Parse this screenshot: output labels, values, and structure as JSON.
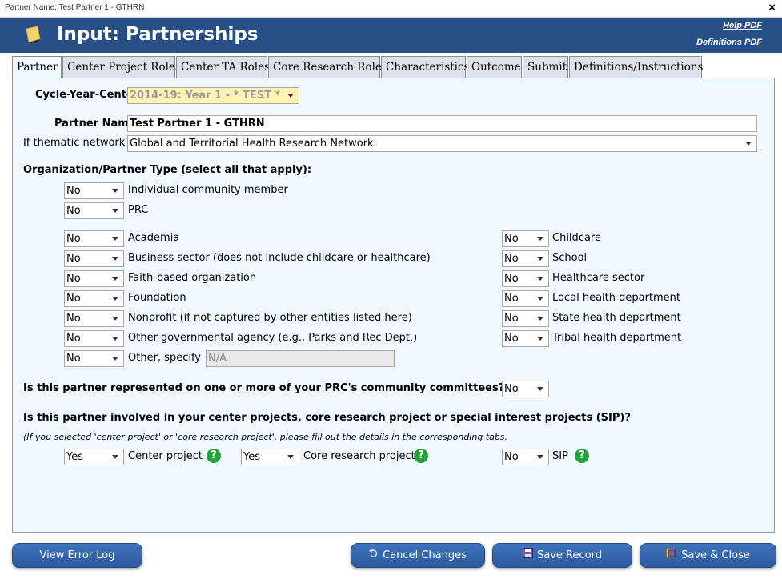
{
  "window": {
    "title": "Partner Name: Test Partner 1 - GTHRN",
    "close_glyph": "×"
  },
  "header": {
    "title": "Input: Partnerships",
    "help_pdf": "Help PDF",
    "definitions_pdf": "Definitions PDF",
    "icon": "note-icon"
  },
  "tabs": [
    {
      "label": "Partner",
      "active": true
    },
    {
      "label": "Center Project Roles"
    },
    {
      "label": "Center TA Roles"
    },
    {
      "label": "Core Research Roles"
    },
    {
      "label": "Characteristics"
    },
    {
      "label": "Outcome"
    },
    {
      "label": "Submit"
    },
    {
      "label": "Definitions/Instructions"
    }
  ],
  "form": {
    "cycle_label": "Cycle-Year-Center",
    "cycle_value": "2014-19: Year 1 - * TEST *",
    "partner_name_label": "Partner Name",
    "partner_name_value": "Test Partner 1 - GTHRN",
    "thematic_label": "If thematic network",
    "thematic_value": "Global and Territorial Health Research Network",
    "org_type_heading": "Organization/Partner Type (select all that apply):",
    "org_top": [
      {
        "value": "No",
        "label": "Individual community member"
      },
      {
        "value": "No",
        "label": "PRC"
      }
    ],
    "org_left": [
      {
        "value": "No",
        "label": "Academia"
      },
      {
        "value": "No",
        "label": "Business sector (does not include childcare or healthcare)"
      },
      {
        "value": "No",
        "label": "Faith-based organization"
      },
      {
        "value": "No",
        "label": "Foundation"
      },
      {
        "value": "No",
        "label": "Nonprofit (if not captured by other entities listed here)"
      },
      {
        "value": "No",
        "label": "Other governmental agency (e.g., Parks and Rec Dept.)"
      },
      {
        "value": "No",
        "label": "Other, specify"
      }
    ],
    "other_specify_value": "N/A",
    "org_right": [
      {
        "value": "No",
        "label": "Childcare"
      },
      {
        "value": "No",
        "label": "School"
      },
      {
        "value": "No",
        "label": "Healthcare sector"
      },
      {
        "value": "No",
        "label": "Local health department"
      },
      {
        "value": "No",
        "label": "State health department"
      },
      {
        "value": "No",
        "label": "Tribal health department"
      }
    ],
    "committee_question": "Is this partner represented on one or more of your PRC's community committees?",
    "committee_value": "No",
    "involved_question": "Is this partner involved in your center projects, core research project or special interest projects (SIP)?",
    "involved_note": "(If you selected 'center project' or 'core research project', please fill out the details in the corresponding tabs.",
    "involvement": [
      {
        "value": "Yes",
        "label": "Center project"
      },
      {
        "value": "Yes",
        "label": "Core research project"
      },
      {
        "value": "No",
        "label": "SIP"
      }
    ],
    "help_glyph": "?"
  },
  "buttons": {
    "error_log": "View Error Log",
    "cancel": "Cancel Changes",
    "save": "Save Record",
    "save_close": "Save & Close"
  },
  "colors": {
    "header_bg": "#284f85",
    "panel_bg": "#f1f8ff",
    "cycle_bg": "#fff3b3",
    "help_green": "#22a33a",
    "button_blue": "#3465ab"
  }
}
